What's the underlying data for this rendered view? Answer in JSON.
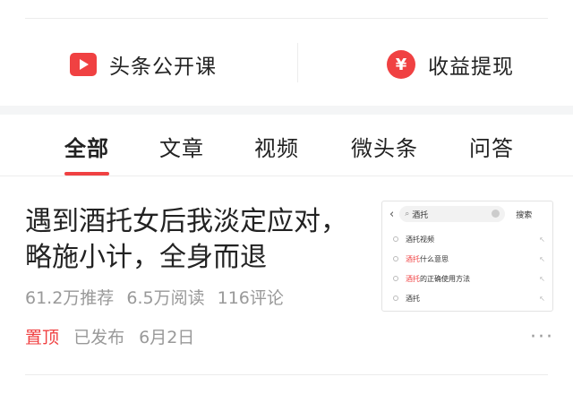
{
  "quick_links": {
    "course": {
      "label": "头条公开课",
      "icon": "play-video-icon",
      "color": "#f04142"
    },
    "withdraw": {
      "label": "收益提现",
      "icon": "yen-icon",
      "icon_glyph": "¥",
      "color": "#f04142"
    }
  },
  "tabs": [
    {
      "label": "全部",
      "active": true
    },
    {
      "label": "文章",
      "active": false
    },
    {
      "label": "视频",
      "active": false
    },
    {
      "label": "微头条",
      "active": false
    },
    {
      "label": "问答",
      "active": false
    }
  ],
  "article": {
    "title": "遇到酒托女后我淡定应对，略施小计，全身而退",
    "stats": {
      "recommend": "61.2万推荐",
      "reads": "6.5万阅读",
      "comments": "116评论"
    },
    "meta": {
      "pinned": "置顶",
      "status": "已发布",
      "date": "6月2日"
    },
    "thumbnail": {
      "search_text": "酒托",
      "search_button": "搜索",
      "suggestions": [
        {
          "prefix": "",
          "highlight": "",
          "text": "酒托视频"
        },
        {
          "prefix": "",
          "highlight": "酒托",
          "text": "什么意思"
        },
        {
          "prefix": "",
          "highlight": "酒托",
          "text": "的正确使用方法"
        },
        {
          "prefix": "",
          "highlight": "",
          "text": "酒托"
        }
      ]
    }
  },
  "accent_color": "#f04142"
}
